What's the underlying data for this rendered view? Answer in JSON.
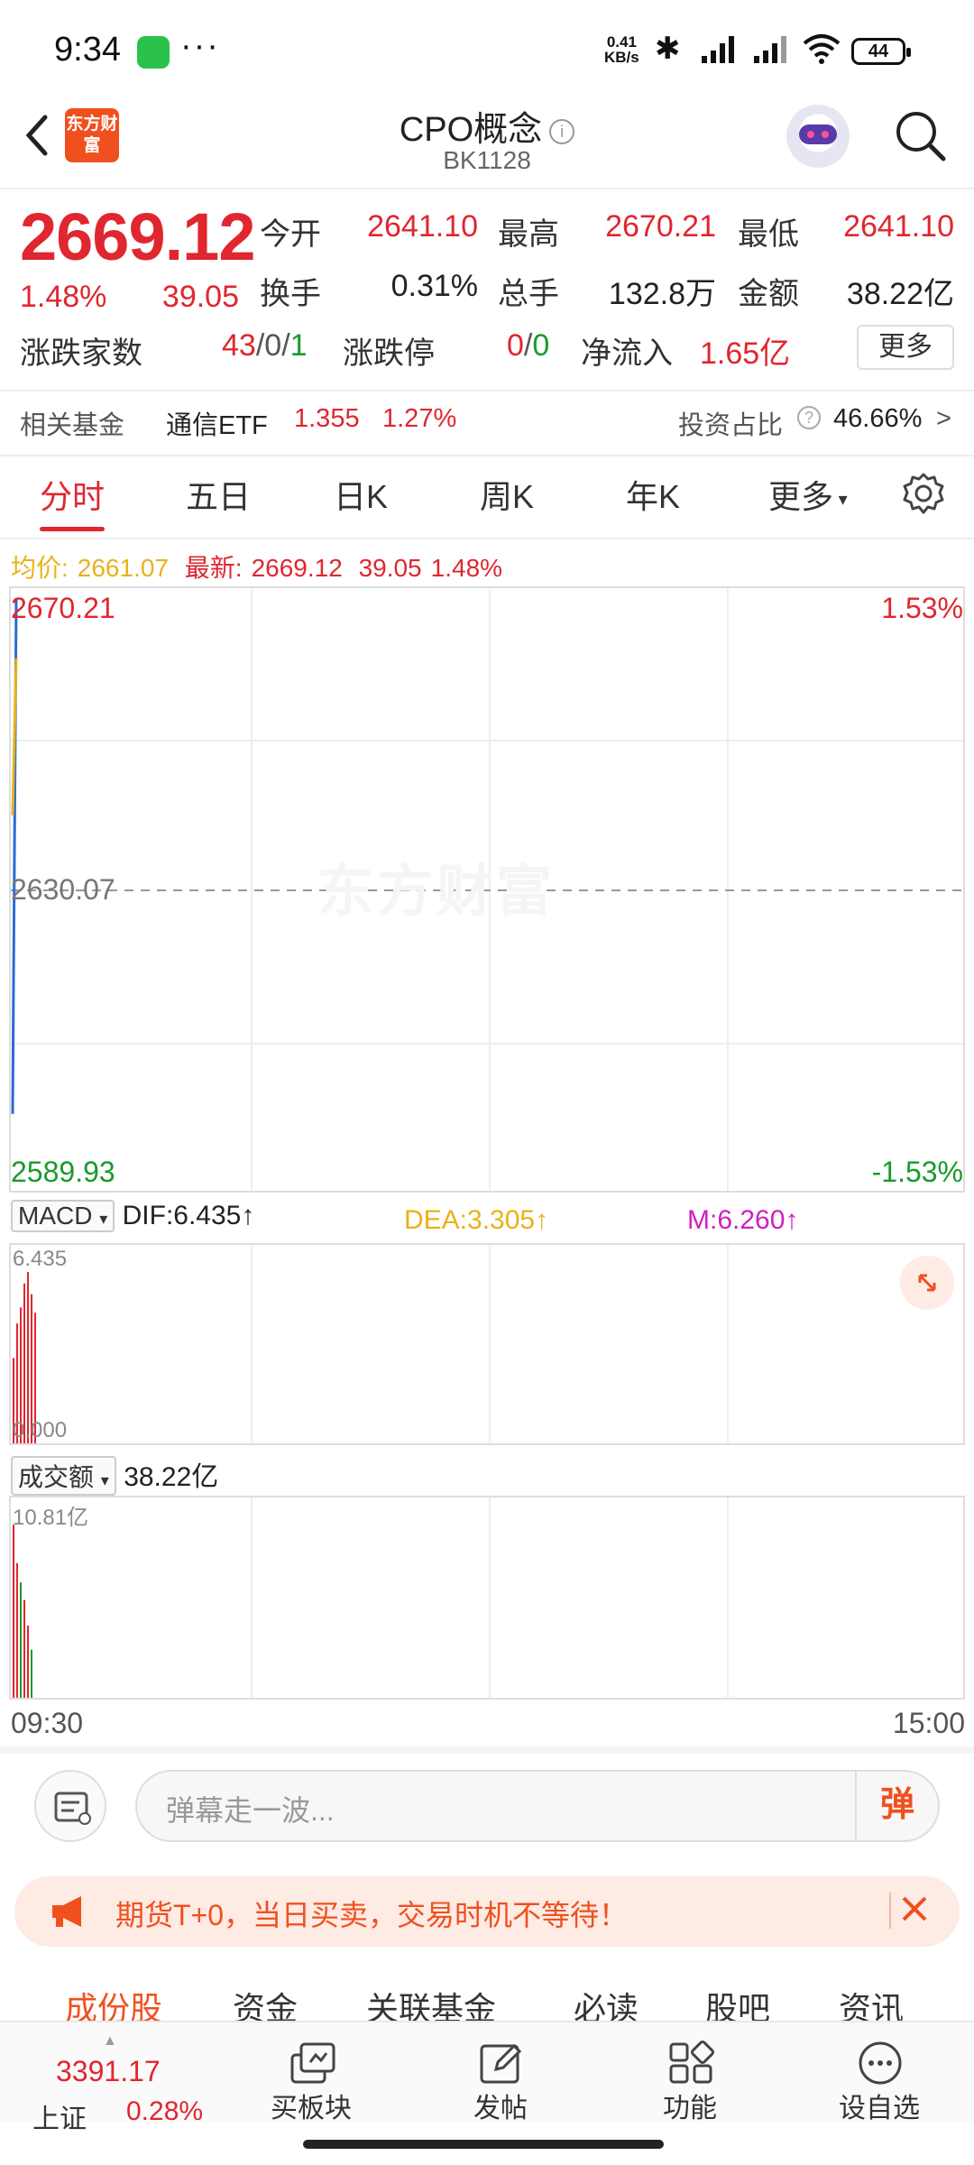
{
  "status_bar": {
    "time": "9:34",
    "net_speed": "0.41",
    "net_unit": "KB/s",
    "battery": "44"
  },
  "header": {
    "logo_text": "东方财富",
    "title": "CPO概念",
    "code": "BK1128"
  },
  "quote": {
    "price": "2669.12",
    "change_pct": "1.48%",
    "change": "39.05",
    "open_label": "今开",
    "open": "2641.10",
    "high_label": "最高",
    "high": "2670.21",
    "low_label": "最低",
    "low": "2641.10",
    "turnover_label": "换手",
    "turnover": "0.31%",
    "volume_label": "总手",
    "volume": "132.8万",
    "amount_label": "金额",
    "amount": "38.22亿",
    "breadth_label": "涨跌家数",
    "up": "43",
    "flat": "0",
    "down": "1",
    "limit_label": "涨跌停",
    "limit_up": "0",
    "limit_down": "0",
    "inflow_label": "净流入",
    "inflow": "1.65亿",
    "more_label": "更多"
  },
  "fund": {
    "label": "相关基金",
    "name": "通信ETF",
    "price": "1.355",
    "pct": "1.27%",
    "ratio_label": "投资占比",
    "ratio": "46.66%"
  },
  "tabs": [
    "分时",
    "五日",
    "日K",
    "周K",
    "年K",
    "更多"
  ],
  "avg_row": {
    "avg_label": "均价:",
    "avg": "2661.07",
    "latest_label": "最新:",
    "latest": "2669.12",
    "chg": "39.05",
    "pct": "1.48%"
  },
  "chart_labels": {
    "top_price": "2670.21",
    "top_pct": "1.53%",
    "mid_price": "2630.07",
    "bottom_price": "2589.93",
    "bottom_pct": "-1.53%",
    "watermark": "东方财富",
    "time_start": "09:30",
    "time_end": "15:00"
  },
  "macd": {
    "selector": "MACD",
    "dif": "DIF:6.435↑",
    "dea": "DEA:3.305↑",
    "m": "M:6.260↑",
    "top": "6.435",
    "bottom": "0.000"
  },
  "turnover_chart": {
    "selector": "成交额",
    "total": "38.22亿",
    "top": "10.81亿"
  },
  "comment": {
    "placeholder": "弹幕走一波...",
    "danmu_label": "弹"
  },
  "promo": {
    "text": "期货T+0，当日买卖，交易时机不等待！"
  },
  "bottom_tabs": [
    "成份股",
    "资金",
    "关联基金",
    "必读",
    "股吧",
    "资讯"
  ],
  "index": {
    "value": "3391.17",
    "name": "上证",
    "pct": "0.28%"
  },
  "bottom_nav": [
    "买板块",
    "发帖",
    "功能",
    "设自选"
  ],
  "colors": {
    "up": "#e0262f",
    "down": "#1a9a2a",
    "avg_line": "#e8b21a",
    "price_line": "#2a6ad8",
    "brand": "#f0501e"
  },
  "chart_data": [
    {
      "type": "line",
      "x": [
        "09:30",
        "09:31"
      ],
      "series": [
        {
          "name": "最新",
          "values": [
            2600.0,
            2669.12
          ]
        },
        {
          "name": "均价",
          "values": [
            2640.0,
            2661.07
          ]
        }
      ],
      "ylim": [
        2589.93,
        2670.21
      ],
      "y2lim": [
        "-1.53%",
        "1.53%"
      ],
      "reference_line": 2630.07,
      "grid": true
    },
    {
      "type": "bar",
      "title": "MACD",
      "values": [
        3.2,
        4.5,
        5.1,
        6.0,
        6.435,
        5.6,
        4.9
      ],
      "ylim": [
        0.0,
        6.435
      ]
    },
    {
      "type": "bar",
      "title": "成交额",
      "values": [
        10.81,
        8.4,
        7.2,
        6.1,
        4.5,
        3.0
      ],
      "ylim": [
        0,
        10.81
      ]
    }
  ]
}
